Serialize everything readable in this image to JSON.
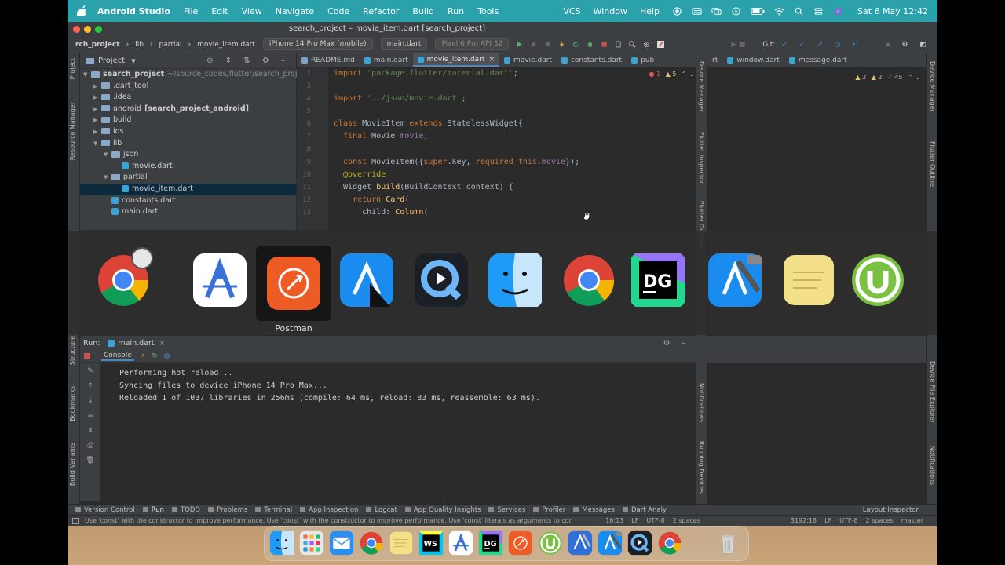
{
  "menubar": {
    "app_name": "Android Studio",
    "items": [
      "File",
      "Edit",
      "View",
      "Navigate",
      "Code",
      "Refactor",
      "Build",
      "Run",
      "Tools"
    ],
    "right_items": [
      "VCS",
      "Window",
      "Help"
    ],
    "clock": "Sat 6 May  12:42"
  },
  "ide": {
    "title": "search_project – movie_item.dart [search_project]",
    "breadcrumb": [
      "rch_project",
      "lib",
      "partial",
      "movie_item.dart"
    ],
    "device_combo": "iPhone 14 Pro Max (mobile)",
    "run_config": "main.dart",
    "emulator_combo": "Pixel 6 Pro API 32",
    "git_label": "Git:",
    "project_panel_title": "Project",
    "tree": [
      {
        "label": "search_project",
        "hint": "~/source_codes/flutter/search_project",
        "bold": true,
        "indent": 0,
        "arrow": "▼"
      },
      {
        "label": ".dart_tool",
        "indent": 1,
        "arrow": "▶"
      },
      {
        "label": ".idea",
        "indent": 1,
        "arrow": "▶"
      },
      {
        "label": "android",
        "hint_bold": "[search_project_android]",
        "indent": 1,
        "arrow": "▶"
      },
      {
        "label": "build",
        "indent": 1,
        "arrow": "▶"
      },
      {
        "label": "ios",
        "indent": 1,
        "arrow": "▶"
      },
      {
        "label": "lib",
        "indent": 1,
        "arrow": "▼"
      },
      {
        "label": "json",
        "indent": 2,
        "arrow": "▼"
      },
      {
        "label": "movie.dart",
        "indent": 3,
        "file": true
      },
      {
        "label": "partial",
        "indent": 2,
        "arrow": "▼"
      },
      {
        "label": "movie_item.dart",
        "indent": 3,
        "file": true,
        "selected": true
      },
      {
        "label": "constants.dart",
        "indent": 2,
        "file": true
      },
      {
        "label": "main.dart",
        "indent": 2,
        "file": true
      }
    ],
    "tabs": [
      {
        "label": "README.md",
        "md": true
      },
      {
        "label": "main.dart"
      },
      {
        "label": "movie_item.dart",
        "active": true
      },
      {
        "label": "movie.dart"
      },
      {
        "label": "constants.dart"
      },
      {
        "label": "pub"
      }
    ],
    "inspection": {
      "errors": "1",
      "warnings": "5"
    },
    "line_numbers": [
      "2",
      "3",
      "4",
      "5",
      "6",
      "7",
      "8",
      "9",
      "10",
      "11",
      "12",
      "13"
    ],
    "code_lines": [
      [
        {
          "t": "import ",
          "c": "kw"
        },
        {
          "t": "'package:flutter/material.dart'",
          "c": "str"
        },
        {
          "t": ";",
          "c": ""
        }
      ],
      [],
      [
        {
          "t": "import ",
          "c": "kw"
        },
        {
          "t": "'../json/movie.dart'",
          "c": "str"
        },
        {
          "t": ";",
          "c": ""
        }
      ],
      [],
      [
        {
          "t": "class ",
          "c": "kw"
        },
        {
          "t": "MovieItem ",
          "c": ""
        },
        {
          "t": "extends ",
          "c": "kw"
        },
        {
          "t": "StatelessWidget{",
          "c": ""
        }
      ],
      [
        {
          "t": "  final ",
          "c": "kw"
        },
        {
          "t": "Movie ",
          "c": ""
        },
        {
          "t": "movie",
          "c": "pr"
        },
        {
          "t": ";",
          "c": ""
        }
      ],
      [],
      [
        {
          "t": "  const ",
          "c": "kw"
        },
        {
          "t": "MovieItem({",
          "c": ""
        },
        {
          "t": "super",
          "c": "kw"
        },
        {
          "t": ".key, ",
          "c": ""
        },
        {
          "t": "required ",
          "c": "kw"
        },
        {
          "t": "this",
          "c": "kw"
        },
        {
          "t": ".",
          "c": ""
        },
        {
          "t": "movie",
          "c": "pr"
        },
        {
          "t": "});",
          "c": ""
        }
      ],
      [
        {
          "t": "  @override",
          "c": "an"
        }
      ],
      [
        {
          "t": "  Widget ",
          "c": ""
        },
        {
          "t": "build",
          "c": "ty"
        },
        {
          "t": "(BuildContext context) {",
          "c": ""
        }
      ],
      [
        {
          "t": "    return ",
          "c": "kw"
        },
        {
          "t": "Card",
          "c": "ty"
        },
        {
          "t": "(",
          "c": ""
        }
      ],
      [
        {
          "t": "      child: ",
          "c": ""
        },
        {
          "t": "Column",
          "c": "ty"
        },
        {
          "t": "(",
          "c": ""
        }
      ]
    ],
    "run": {
      "label": "Run:",
      "config_tab": "main.dart",
      "console_tab": "Console",
      "lines": [
        "Performing hot reload...",
        "Syncing files to device iPhone 14 Pro Max...",
        "Reloaded 1 of 1037 libraries in 256ms (compile: 64 ms, reload: 83 ms, reassemble: 63 ms)."
      ]
    },
    "left_strip": [
      "Project",
      "Resource Manager",
      "Structure",
      "Bookmarks",
      "Build Variants"
    ],
    "right_strip": [
      "Device Manager",
      "Flutter Inspector",
      "Flutter Outline",
      "Notifications",
      "Running Devices"
    ],
    "bottom_tabs": [
      "Version Control",
      "Run",
      "TODO",
      "Problems",
      "Terminal",
      "App Inspection",
      "Logcat",
      "App Quality Insights",
      "Services",
      "Profiler",
      "Messages",
      "Dart Analy"
    ],
    "status_message": "Use 'const' with the constructor to improve performance. Use 'const' with the constructor to improve performance. Use 'const' literals as arguments to constr...",
    "status_right": [
      "16:13",
      "LF",
      "UTF-8",
      "2 spaces"
    ]
  },
  "ide2": {
    "tabs": [
      "rt",
      "window.dart",
      "message.dart"
    ],
    "inspection": {
      "w1": "2",
      "w2": "2",
      "ok": "45"
    },
    "git_label": "Git:",
    "layout_inspector": "Layout Inspector",
    "status_right": [
      "3192:18",
      "LF",
      "UTF-8",
      "2 spaces",
      "master"
    ],
    "right_strip": [
      "Device Manager",
      "Flutter Outline",
      "Device File Explorer",
      "Notifications"
    ]
  },
  "switcher": {
    "selected_label": "Postman",
    "apps": [
      "chrome-icon",
      "android-studio-icon",
      "postman-icon",
      "xcode-instruments-icon",
      "quicktime-icon",
      "finder-icon",
      "chrome-icon",
      "datagrip-icon",
      "xcode-icon",
      "stickies-icon",
      "utorrent-icon"
    ]
  },
  "dock": {
    "apps": [
      "finder-icon",
      "launchpad-icon",
      "mail-icon",
      "chrome-icon",
      "stickies-icon",
      "webstorm-icon",
      "android-studio-icon",
      "datagrip-icon",
      "postman-icon",
      "utorrent-icon",
      "instruments-icon",
      "xcode-icon",
      "quicktime-icon",
      "chrome-icon",
      "trash-icon"
    ]
  },
  "colors": {
    "menubar": "#2aa1ab",
    "ide_bg": "#2b2b2b",
    "panel": "#3c3f41",
    "selection": "#0d293e",
    "accent": "#4a88c7"
  }
}
